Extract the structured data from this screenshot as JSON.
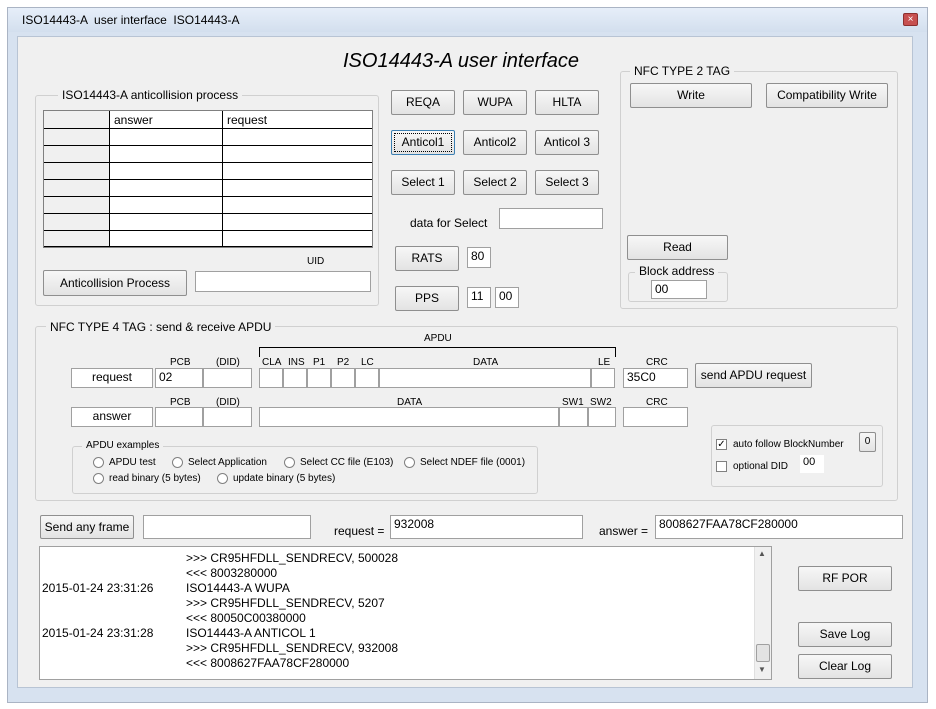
{
  "window": {
    "title": "ISO14443-A  user interface  ISO14443-A",
    "close": "×"
  },
  "heading": "ISO14443-A user interface",
  "anticollision": {
    "group_label": "ISO14443-A anticollision process",
    "col_answer": "answer",
    "col_request": "request",
    "uid_label": "UID",
    "process_button": "Anticollision Process",
    "uid_value": ""
  },
  "commands": {
    "reqa": "REQA",
    "wupa": "WUPA",
    "hlta": "HLTA",
    "anticol1": "Anticol1",
    "anticol2": "Anticol2",
    "anticol3": "Anticol 3",
    "select1": "Select 1",
    "select2": "Select 2",
    "select3": "Select 3",
    "data_for_select_label": "data for Select",
    "data_for_select_value": "",
    "rats": "RATS",
    "rats_value": "80",
    "pps": "PPS",
    "pps_value1": "11",
    "pps_value2": "00"
  },
  "nfc2": {
    "group_label": "NFC TYPE 2 TAG",
    "write": "Write",
    "compat_write": "Compatibility Write",
    "read": "Read",
    "block_address_label": "Block address",
    "block_address_value": "00"
  },
  "nfc4": {
    "group_label": "NFC TYPE 4 TAG : send & receive APDU",
    "apdu_label": "APDU",
    "headers": {
      "pcb": "PCB",
      "did": "(DID)",
      "cla": "CLA",
      "ins": "INS",
      "p1": "P1",
      "p2": "P2",
      "lc": "LC",
      "data": "DATA",
      "le": "LE",
      "crc": "CRC",
      "sw1": "SW1",
      "sw2": "SW2"
    },
    "request_label": "request",
    "answer_label": "answer",
    "request_pcb": "02",
    "request_crc": "35C0",
    "send_button": "send APDU request",
    "examples_label": "APDU examples",
    "examples": [
      "APDU test",
      "Select Application",
      "Select CC file (E103)",
      "Select NDEF file  (0001)",
      "read binary (5 bytes)",
      "update binary (5 bytes)"
    ],
    "auto_follow_label": "auto follow BlockNumber",
    "auto_follow_checked": "✓",
    "auto_follow_value": "0",
    "optional_did_label": "optional DID",
    "optional_did_value": "00"
  },
  "bottom": {
    "send_any_frame": "Send any frame",
    "frame_value": "",
    "request_label": "request =",
    "request_value": "932008",
    "answer_label": "answer =",
    "answer_value": "8008627FAA78CF280000"
  },
  "log": {
    "lines": [
      {
        "time": "",
        "text": ">>> CR95HFDLL_SENDRECV, 500028"
      },
      {
        "time": "",
        "text": "<<< 8003280000"
      },
      {
        "time": "2015-01-24 23:31:26",
        "text": "ISO14443-A WUPA"
      },
      {
        "time": "",
        "text": ">>> CR95HFDLL_SENDRECV, 5207"
      },
      {
        "time": "",
        "text": "<<< 80050C00380000"
      },
      {
        "time": "2015-01-24 23:31:28",
        "text": "ISO14443-A ANTICOL 1"
      },
      {
        "time": "",
        "text": ">>> CR95HFDLL_SENDRECV, 932008"
      },
      {
        "time": "",
        "text": "<<< 8008627FAA78CF280000"
      }
    ],
    "scroll_up": "▲",
    "scroll_down": "▼"
  },
  "side_buttons": {
    "rf_por": "RF POR",
    "save_log": "Save Log",
    "clear_log": "Clear Log"
  }
}
